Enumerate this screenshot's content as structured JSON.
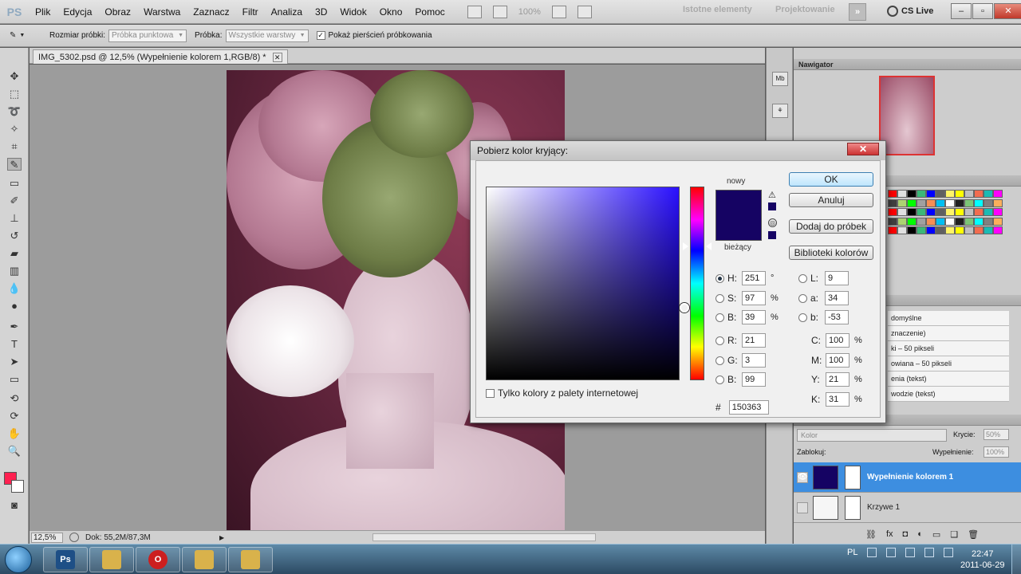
{
  "app": {
    "logo": "PS"
  },
  "menu": {
    "items": [
      "Plik",
      "Edycja",
      "Obraz",
      "Warstwa",
      "Zaznacz",
      "Filtr",
      "Analiza",
      "3D",
      "Widok",
      "Okno",
      "Pomoc"
    ],
    "zoom": "100%",
    "workspace_1": "Istotne elementy",
    "workspace_2": "Projektowanie",
    "cslive": "CS Live"
  },
  "options": {
    "sample_size_label": "Rozmiar próbki:",
    "sample_size_value": "Próbka punktowa",
    "sample_label": "Próbka:",
    "sample_value": "Wszystkie warstwy",
    "show_ring_label": "Pokaż pierścień próbkowania",
    "show_ring_checked": "✓"
  },
  "document": {
    "tab_title": "IMG_5302.psd @ 12,5% (Wypełnienie kolorem 1,RGB/8) *",
    "zoom": "12,5%",
    "doc_info": "Dok: 55,2M/87,3M"
  },
  "panels": {
    "navigator_title": "Nawigator",
    "styles": [
      "domyślne",
      "znaczenie)",
      "ki – 50 pikseli",
      "owiana – 50 pikseli",
      "enia (tekst)",
      "wodzie (tekst)"
    ],
    "blend_mode": "Kolor",
    "opacity_label": "Krycie:",
    "opacity_value": "50%",
    "lock_label": "Zablokuj:",
    "fill_label": "Wypełnienie:",
    "fill_value": "100%",
    "layers": [
      {
        "name": "Wypełnienie kolorem 1",
        "active": true
      },
      {
        "name": "Krzywe 1",
        "active": false
      }
    ]
  },
  "dialog": {
    "title": "Pobierz kolor kryjący:",
    "new_label": "nowy",
    "current_label": "bieżący",
    "new_color": "#150363",
    "current_color": "#150363",
    "web_only_label": "Tylko kolory z palety internetowej",
    "buttons": {
      "ok": "OK",
      "cancel": "Anuluj",
      "add_swatches": "Dodaj do próbek",
      "libraries": "Biblioteki kolorów"
    },
    "fields": {
      "H": {
        "label": "H:",
        "value": "251",
        "unit": "°"
      },
      "S": {
        "label": "S:",
        "value": "97",
        "unit": "%"
      },
      "Bv": {
        "label": "B:",
        "value": "39",
        "unit": "%"
      },
      "R": {
        "label": "R:",
        "value": "21",
        "unit": ""
      },
      "G": {
        "label": "G:",
        "value": "3",
        "unit": ""
      },
      "B": {
        "label": "B:",
        "value": "99",
        "unit": ""
      },
      "L": {
        "label": "L:",
        "value": "9",
        "unit": ""
      },
      "a": {
        "label": "a:",
        "value": "34",
        "unit": ""
      },
      "b": {
        "label": "b:",
        "value": "-53",
        "unit": ""
      },
      "C": {
        "label": "C:",
        "value": "100",
        "unit": "%"
      },
      "M": {
        "label": "M:",
        "value": "100",
        "unit": "%"
      },
      "Y": {
        "label": "Y:",
        "value": "21",
        "unit": "%"
      },
      "K": {
        "label": "K:",
        "value": "31",
        "unit": "%"
      }
    },
    "hex_label": "#",
    "hex_value": "150363"
  },
  "taskbar": {
    "language": "PL",
    "time": "22:47",
    "date": "2011-06-29"
  }
}
